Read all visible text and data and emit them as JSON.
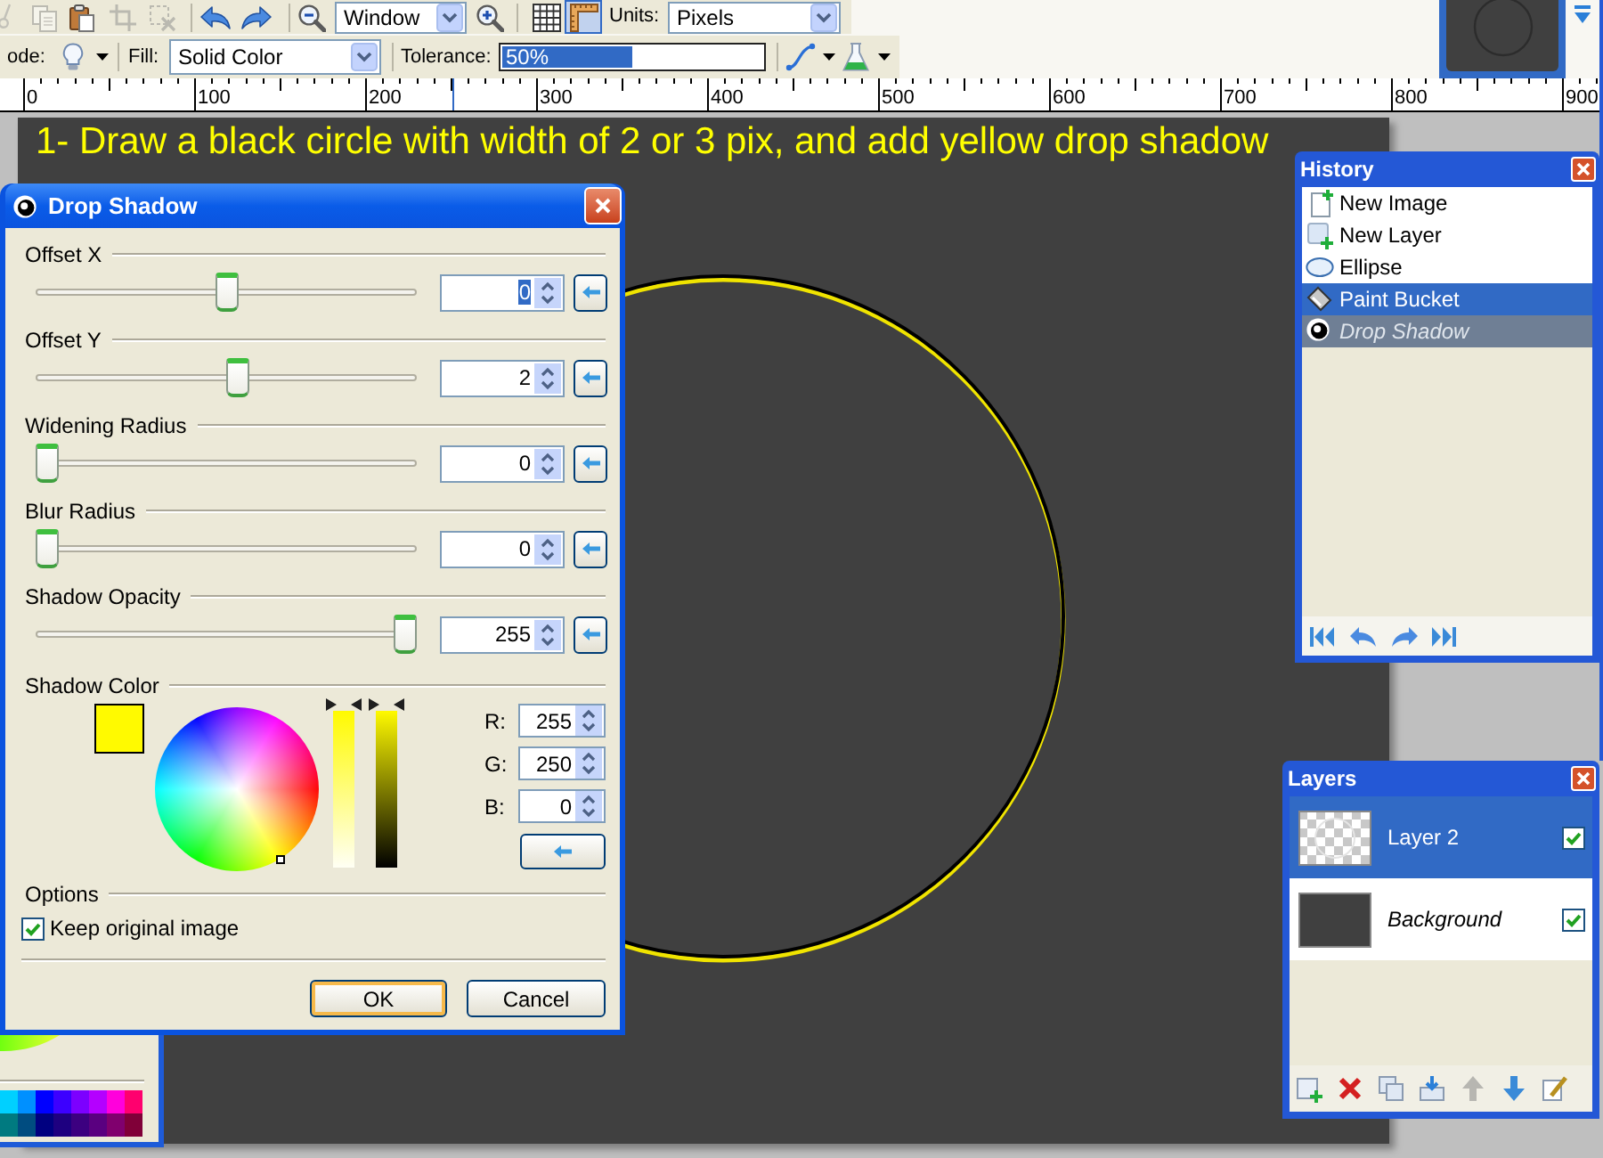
{
  "toolbar": {
    "edit_buttons": [
      {
        "kind": "cut",
        "disabled": true
      },
      {
        "kind": "copy",
        "disabled": true
      },
      {
        "kind": "paste",
        "disabled": false
      },
      {
        "kind": "crop",
        "disabled": true
      },
      {
        "kind": "deselect",
        "disabled": true
      }
    ],
    "zoom": {
      "value": "Window"
    },
    "view_toggles": [
      {
        "kind": "grid",
        "on": false
      },
      {
        "kind": "rulers",
        "on": true
      }
    ],
    "units_label": "Units:",
    "units": {
      "value": "Pixels"
    }
  },
  "tool_options": {
    "mode_label": "ode:",
    "fill_label": "Fill:",
    "fill": {
      "value": "Solid Color"
    },
    "tolerance_label": "Tolerance:",
    "tolerance": {
      "reading": "50%",
      "level": 0.5
    }
  },
  "ruler": {
    "labels": [
      "0",
      "100",
      "200",
      "300",
      "400",
      "500",
      "600",
      "700",
      "800",
      "900"
    ]
  },
  "canvas": {
    "caption": "1- Draw a black circle with width of 2 or 3 pix, and add yellow drop shadow"
  },
  "colors_panel": {
    "palette": [
      {
        "color": "#00d0ff"
      },
      {
        "color": "#0090ff"
      },
      {
        "color": "#0000ff"
      },
      {
        "color": "#3c00ff"
      },
      {
        "color": "#7c00ff"
      },
      {
        "color": "#b400ff"
      },
      {
        "color": "#ff00dc"
      },
      {
        "color": "#ff006e"
      },
      {
        "color": "#007a80"
      },
      {
        "color": "#004c80"
      },
      {
        "color": "#000080"
      },
      {
        "color": "#1e0080"
      },
      {
        "color": "#3c0080"
      },
      {
        "color": "#5a0080"
      },
      {
        "color": "#80006e"
      },
      {
        "color": "#800038"
      }
    ]
  },
  "dialog": {
    "title": "Drop Shadow",
    "sliders": [
      {
        "label": "Offset X",
        "level": 0.5,
        "value": "0",
        "focused": true
      },
      {
        "label": "Offset Y",
        "level": 0.53,
        "value": "2",
        "focused": false
      },
      {
        "label": "Widening Radius",
        "level": 0,
        "value": "0",
        "focused": false
      },
      {
        "label": "Blur Radius",
        "level": 0,
        "value": "0",
        "focused": false
      },
      {
        "label": "Shadow Opacity",
        "level": 1,
        "value": "255",
        "focused": false
      }
    ],
    "shadow_color": {
      "label": "Shadow Color",
      "color": "#fffa00",
      "channels": [
        {
          "label": "R:",
          "value": "255"
        },
        {
          "label": "G:",
          "value": "250"
        },
        {
          "label": "B:",
          "value": "0"
        }
      ]
    },
    "options": {
      "label": "Options",
      "keep_original": {
        "label": "Keep original image",
        "checked": true
      }
    },
    "buttons": [
      {
        "label": "OK",
        "default": true
      },
      {
        "label": "Cancel",
        "default": false
      }
    ]
  },
  "history": {
    "title": "History",
    "items": [
      {
        "kind": "new_image",
        "label": "New Image",
        "selected": false,
        "pending": false
      },
      {
        "kind": "new_layer",
        "label": "New Layer",
        "selected": false,
        "pending": false
      },
      {
        "kind": "ellipse",
        "label": "Ellipse",
        "selected": false,
        "pending": false
      },
      {
        "kind": "paint_bucket",
        "label": "Paint Bucket",
        "selected": true,
        "pending": false
      },
      {
        "kind": "drop_shadow",
        "label": "Drop Shadow",
        "selected": false,
        "pending": true
      }
    ]
  },
  "layers": {
    "title": "Layers",
    "items": [
      {
        "kind": "layer",
        "label": "Layer 2",
        "selected": true,
        "visible": true
      },
      {
        "kind": "background",
        "label": "Background",
        "selected": false,
        "visible": true
      }
    ],
    "tools": [
      {
        "kind": "add",
        "disabled": false
      },
      {
        "kind": "delete",
        "disabled": false
      },
      {
        "kind": "duplicate",
        "disabled": false
      },
      {
        "kind": "merge_down",
        "disabled": false
      },
      {
        "kind": "move_up",
        "disabled": true
      },
      {
        "kind": "move_down",
        "disabled": false
      },
      {
        "kind": "properties",
        "disabled": false
      }
    ]
  }
}
